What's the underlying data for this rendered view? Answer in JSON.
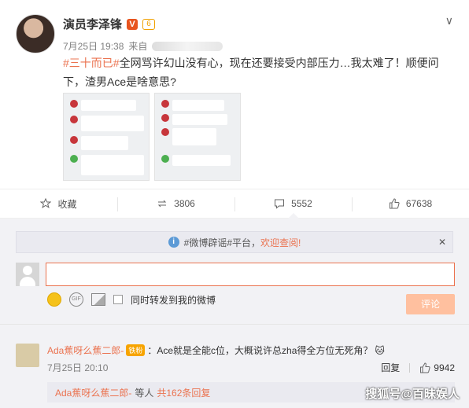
{
  "post": {
    "author": "演员李泽锋",
    "badge_v": "V",
    "badge_member": "6",
    "timestamp": "7月25日 19:38",
    "source_prefix": "来自",
    "hashtag": "#三十而已#",
    "text": "全网骂许幻山没有心，现在还要接受内部压力…我太难了！顺便问下，渣男Ace是啥意思?",
    "images": [
      "chat-screenshot-1",
      "chat-screenshot-2"
    ]
  },
  "actions": {
    "favorite_label": "收藏",
    "repost_count": "3806",
    "comment_count": "5552",
    "like_count": "67638"
  },
  "comments": {
    "notice_text": "#微博辟谣#平台，",
    "notice_link": "欢迎查阅!",
    "input_value": "",
    "share_label": "同时转发到我的微博",
    "submit_label": "评论",
    "items": [
      {
        "user": "Ada蕉呀么蕉二郎-",
        "vip": "铁粉",
        "text": "：Ace就是全能c位，大概说许总zha得全方位无死角？",
        "date": "7月25日 20:10",
        "reply_label": "回复",
        "likes": "9942"
      }
    ],
    "sub_reply": {
      "user": "Ada蕉呀么蕉二郎-",
      "middle": "等人",
      "count": "共162条回复"
    }
  },
  "watermark": "搜狐号@百昧娱人",
  "colors": {
    "accent": "#eb7350",
    "submit_disabled": "#ffc09f",
    "bg": "#f2f2f5"
  }
}
